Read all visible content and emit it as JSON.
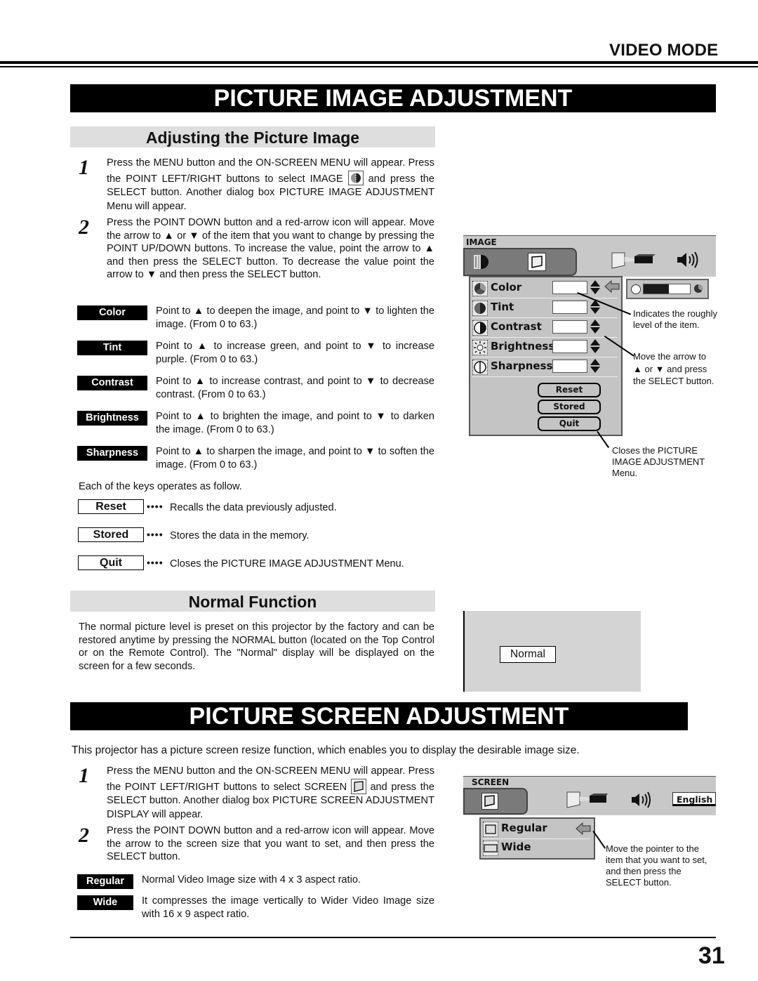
{
  "header": {
    "section": "VIDEO MODE"
  },
  "picture_image_adjustment": {
    "title": "PICTURE IMAGE ADJUSTMENT",
    "subsection": "Adjusting the Picture Image",
    "steps": [
      {
        "num": "1",
        "text": "Press the MENU button and the ON-SCREEN MENU will appear. Press the POINT LEFT/RIGHT buttons to select IMAGE",
        "text_after_icon": "and press the SELECT button.  Another dialog box PICTURE IMAGE ADJUSTMENT Menu will appear.",
        "icon": "image-menu-icon"
      },
      {
        "num": "2",
        "text": "Press the POINT DOWN button and a red-arrow icon will appear. Move the arrow to ▲ or ▼ of the item that you want to change by pressing the POINT UP/DOWN buttons.  To increase the value, point the arrow to ▲ and then press the SELECT button.  To decrease the value point the arrow to ▼ and then press the SELECT button."
      }
    ],
    "items": [
      {
        "label": "Color",
        "desc": "Point to ▲ to deepen the image, and point to ▼ to lighten the image.  (From 0 to 63.)"
      },
      {
        "label": "Tint",
        "desc": "Point to ▲ to increase green, and point to ▼ to increase purple.  (From 0 to 63.)"
      },
      {
        "label": "Contrast",
        "desc": "Point to ▲ to increase contrast, and point to ▼ to decrease contrast.  (From 0 to 63.)"
      },
      {
        "label": "Brightness",
        "desc": "Point to ▲ to brighten the image, and point to ▼ to darken the image.  (From 0 to 63.)"
      },
      {
        "label": "Sharpness",
        "desc": "Point to ▲ to sharpen the image, and point to ▼ to soften the image.  (From 0 to 63.)"
      }
    ],
    "keys_intro": "Each of the keys operates as follow.",
    "keys": [
      {
        "label": "Reset",
        "dots": "••••",
        "desc": "Recalls the data previously adjusted."
      },
      {
        "label": "Stored",
        "dots": "••••",
        "desc": "Stores the data in the memory."
      },
      {
        "label": "Quit",
        "dots": "••••",
        "desc": "Closes the PICTURE IMAGE ADJUSTMENT Menu."
      }
    ],
    "osd": {
      "title": "IMAGE",
      "rows": [
        "Color",
        "Tint",
        "Contrast",
        "Brightness",
        "Sharpness"
      ],
      "buttons": [
        "Reset",
        "Stored",
        "Quit"
      ],
      "level_fraction": 0.55,
      "notes": {
        "level": "Indicates the roughly level of the item.",
        "arrow": "Move the arrow to ▲ or ▼ and press the SELECT button.",
        "quit": "Closes the PICTURE IMAGE ADJUSTMENT Menu."
      }
    }
  },
  "normal_function": {
    "subsection": "Normal Function",
    "text": "The normal picture level is preset on this projector by the factory and can be restored anytime by pressing the NORMAL button (located on the Top Control or on the Remote Control).  The \"Normal\" display will be displayed on the screen for a few seconds.",
    "display_label": "Normal"
  },
  "picture_screen_adjustment": {
    "title": "PICTURE SCREEN ADJUSTMENT",
    "intro": "This projector has a picture screen resize function, which enables you to display the desirable image size.",
    "steps": [
      {
        "num": "1",
        "text": "Press the MENU button and the ON-SCREEN MENU will appear. Press the POINT LEFT/RIGHT buttons to select SCREEN",
        "text_after_icon": "and press the SELECT button.  Another dialog box PICTURE SCREEN ADJUSTMENT DISPLAY will appear.",
        "icon": "screen-menu-icon"
      },
      {
        "num": "2",
        "text": "Press the POINT DOWN button and a red-arrow icon will appear. Move the arrow to the screen size that you want to set, and then press the SELECT button."
      }
    ],
    "items": [
      {
        "label": "Regular",
        "desc": "Normal Video Image size with 4 x 3 aspect ratio."
      },
      {
        "label": "Wide",
        "desc": "It compresses the image vertically to Wider Video Image size with 16 x 9 aspect ratio."
      }
    ],
    "osd": {
      "title": "SCREEN",
      "language": "English",
      "rows": [
        "Regular",
        "Wide"
      ],
      "note": "Move the pointer to the item that you want to set, and then press the SELECT button."
    }
  },
  "footer": {
    "page_number": "31"
  }
}
